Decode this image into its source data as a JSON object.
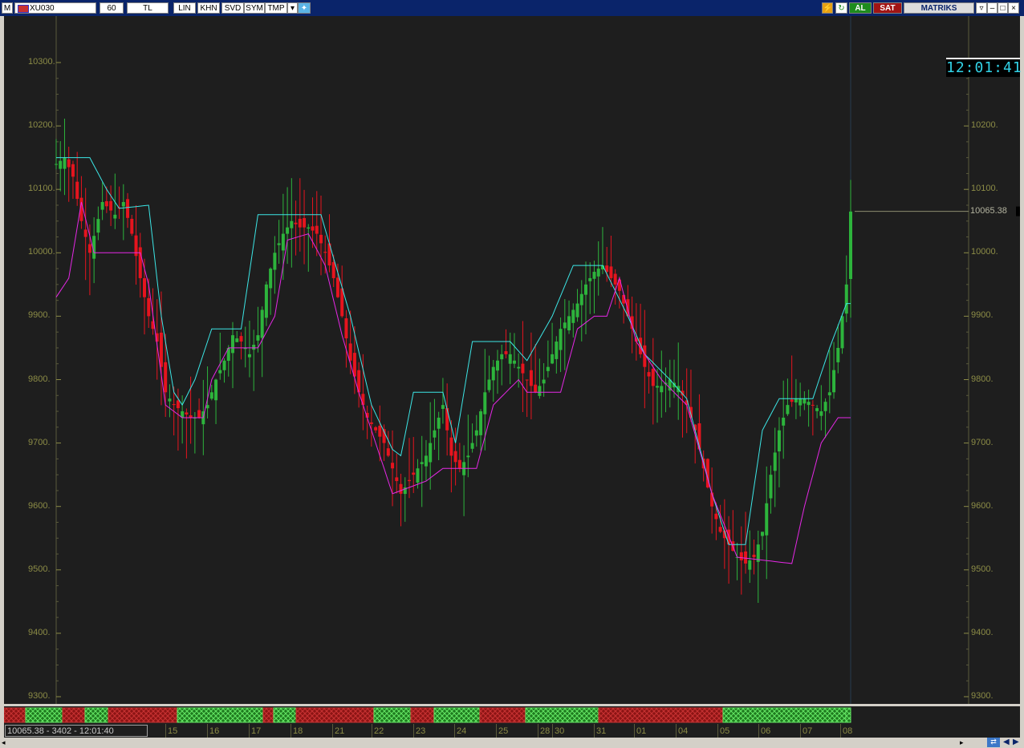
{
  "toolbar": {
    "m_label": "M",
    "symbol": "XU030",
    "period": "60",
    "currency": "TL",
    "buttons": [
      "LIN",
      "KHN",
      "SVD",
      "SYM",
      "TMP"
    ],
    "buy_label": "AL",
    "sell_label": "SAT",
    "brand": "MATRIKS"
  },
  "clock": "12:01:41",
  "last_price_label": "10065.38",
  "status_text": "10065.38 - 3402 - 12:01:40",
  "colors": {
    "background": "#1e1e1e",
    "bull": "#2db43c",
    "bear": "#e6141e",
    "upper_band": "#3ce6e6",
    "lower_band": "#e628e6",
    "axis_text": "#8c8c46",
    "buy": "#1e8c1e",
    "sell": "#a01414"
  },
  "chart_data": {
    "type": "candlestick",
    "y_ticks": [
      "10300.",
      "10200.",
      "10100.",
      "10000.",
      "9900.",
      "9800.",
      "9700.",
      "9600.",
      "9500.",
      "9400.",
      "9300."
    ],
    "ylim": [
      9300,
      10300
    ],
    "x_labels": [
      "15",
      "16",
      "17",
      "18",
      "21",
      "22",
      "23",
      "24",
      "25",
      "28",
      "30",
      "31",
      "01",
      "04",
      "05",
      "06",
      "07",
      "08"
    ],
    "last_price": 10065.38,
    "series": [
      {
        "name": "upper_band",
        "points": [
          [
            0,
            10150
          ],
          [
            8,
            10150
          ],
          [
            12,
            10100
          ],
          [
            15,
            10070
          ],
          [
            22,
            10075
          ],
          [
            25,
            9900
          ],
          [
            28,
            9780
          ],
          [
            30,
            9760
          ],
          [
            33,
            9800
          ],
          [
            37,
            9880
          ],
          [
            44,
            9880
          ],
          [
            48,
            10060
          ],
          [
            63,
            10060
          ],
          [
            70,
            9900
          ],
          [
            75,
            9760
          ],
          [
            80,
            9690
          ],
          [
            82,
            9680
          ],
          [
            85,
            9780
          ],
          [
            92,
            9780
          ],
          [
            95,
            9700
          ],
          [
            99,
            9860
          ],
          [
            108,
            9860
          ],
          [
            112,
            9830
          ],
          [
            118,
            9900
          ],
          [
            123,
            9980
          ],
          [
            130,
            9980
          ],
          [
            136,
            9900
          ],
          [
            140,
            9840
          ],
          [
            146,
            9800
          ],
          [
            150,
            9770
          ],
          [
            156,
            9620
          ],
          [
            160,
            9540
          ],
          [
            164,
            9540
          ],
          [
            168,
            9720
          ],
          [
            172,
            9770
          ],
          [
            180,
            9770
          ],
          [
            184,
            9850
          ],
          [
            188,
            9920
          ]
        ]
      },
      {
        "name": "lower_band",
        "points": [
          [
            0,
            9930
          ],
          [
            3,
            9960
          ],
          [
            6,
            10080
          ],
          [
            9,
            10000
          ],
          [
            20,
            10000
          ],
          [
            22,
            9950
          ],
          [
            26,
            9760
          ],
          [
            30,
            9740
          ],
          [
            35,
            9740
          ],
          [
            37,
            9800
          ],
          [
            41,
            9850
          ],
          [
            48,
            9850
          ],
          [
            52,
            9900
          ],
          [
            55,
            10020
          ],
          [
            60,
            10030
          ],
          [
            64,
            9980
          ],
          [
            68,
            9870
          ],
          [
            72,
            9780
          ],
          [
            76,
            9700
          ],
          [
            80,
            9620
          ],
          [
            88,
            9640
          ],
          [
            92,
            9660
          ],
          [
            100,
            9660
          ],
          [
            104,
            9760
          ],
          [
            110,
            9800
          ],
          [
            112,
            9780
          ],
          [
            120,
            9780
          ],
          [
            124,
            9880
          ],
          [
            128,
            9900
          ],
          [
            131,
            9900
          ],
          [
            134,
            9960
          ],
          [
            138,
            9860
          ],
          [
            144,
            9800
          ],
          [
            150,
            9760
          ],
          [
            156,
            9620
          ],
          [
            162,
            9520
          ],
          [
            175,
            9510
          ],
          [
            178,
            9600
          ],
          [
            182,
            9700
          ],
          [
            186,
            9740
          ],
          [
            189,
            9740
          ]
        ]
      },
      {
        "name": "price",
        "points": [
          [
            0,
            10140
          ],
          [
            2,
            10150
          ],
          [
            4,
            10120
          ],
          [
            6,
            10050
          ],
          [
            8,
            10000
          ],
          [
            11,
            10080
          ],
          [
            14,
            10060
          ],
          [
            16,
            10080
          ],
          [
            18,
            10030
          ],
          [
            20,
            9960
          ],
          [
            22,
            9900
          ],
          [
            24,
            9860
          ],
          [
            26,
            9780
          ],
          [
            28,
            9760
          ],
          [
            30,
            9750
          ],
          [
            32,
            9740
          ],
          [
            34,
            9740
          ],
          [
            36,
            9760
          ],
          [
            38,
            9800
          ],
          [
            40,
            9830
          ],
          [
            42,
            9870
          ],
          [
            44,
            9860
          ],
          [
            46,
            9840
          ],
          [
            48,
            9870
          ],
          [
            50,
            9950
          ],
          [
            52,
            10000
          ],
          [
            54,
            10030
          ],
          [
            56,
            10050
          ],
          [
            58,
            10040
          ],
          [
            60,
            10040
          ],
          [
            62,
            10030
          ],
          [
            64,
            10000
          ],
          [
            66,
            9960
          ],
          [
            68,
            9900
          ],
          [
            70,
            9830
          ],
          [
            72,
            9780
          ],
          [
            74,
            9740
          ],
          [
            76,
            9720
          ],
          [
            78,
            9700
          ],
          [
            80,
            9660
          ],
          [
            82,
            9620
          ],
          [
            84,
            9640
          ],
          [
            86,
            9660
          ],
          [
            88,
            9680
          ],
          [
            90,
            9720
          ],
          [
            92,
            9760
          ],
          [
            94,
            9680
          ],
          [
            96,
            9660
          ],
          [
            98,
            9680
          ],
          [
            100,
            9720
          ],
          [
            102,
            9780
          ],
          [
            104,
            9820
          ],
          [
            106,
            9840
          ],
          [
            108,
            9840
          ],
          [
            110,
            9820
          ],
          [
            112,
            9800
          ],
          [
            114,
            9780
          ],
          [
            116,
            9800
          ],
          [
            118,
            9840
          ],
          [
            120,
            9880
          ],
          [
            122,
            9900
          ],
          [
            124,
            9920
          ],
          [
            126,
            9950
          ],
          [
            128,
            9970
          ],
          [
            130,
            9980
          ],
          [
            132,
            9960
          ],
          [
            134,
            9940
          ],
          [
            136,
            9900
          ],
          [
            138,
            9860
          ],
          [
            140,
            9820
          ],
          [
            142,
            9790
          ],
          [
            144,
            9790
          ],
          [
            146,
            9800
          ],
          [
            148,
            9790
          ],
          [
            150,
            9760
          ],
          [
            152,
            9720
          ],
          [
            154,
            9660
          ],
          [
            156,
            9600
          ],
          [
            158,
            9560
          ],
          [
            160,
            9540
          ],
          [
            162,
            9520
          ],
          [
            164,
            9510
          ],
          [
            166,
            9520
          ],
          [
            168,
            9560
          ],
          [
            170,
            9650
          ],
          [
            172,
            9720
          ],
          [
            174,
            9760
          ],
          [
            176,
            9770
          ],
          [
            178,
            9770
          ],
          [
            180,
            9760
          ],
          [
            182,
            9750
          ],
          [
            184,
            9780
          ],
          [
            186,
            9850
          ],
          [
            188,
            9950
          ],
          [
            189,
            10065
          ]
        ]
      }
    ],
    "bull_bear_strip": [
      "bear",
      "bull",
      "bear",
      "bull",
      "bear",
      "bull",
      "bear",
      "bull",
      "bear",
      "bull",
      "bear",
      "bull",
      "bear",
      "bull",
      "bear",
      "bull",
      "bear",
      "bull"
    ]
  }
}
